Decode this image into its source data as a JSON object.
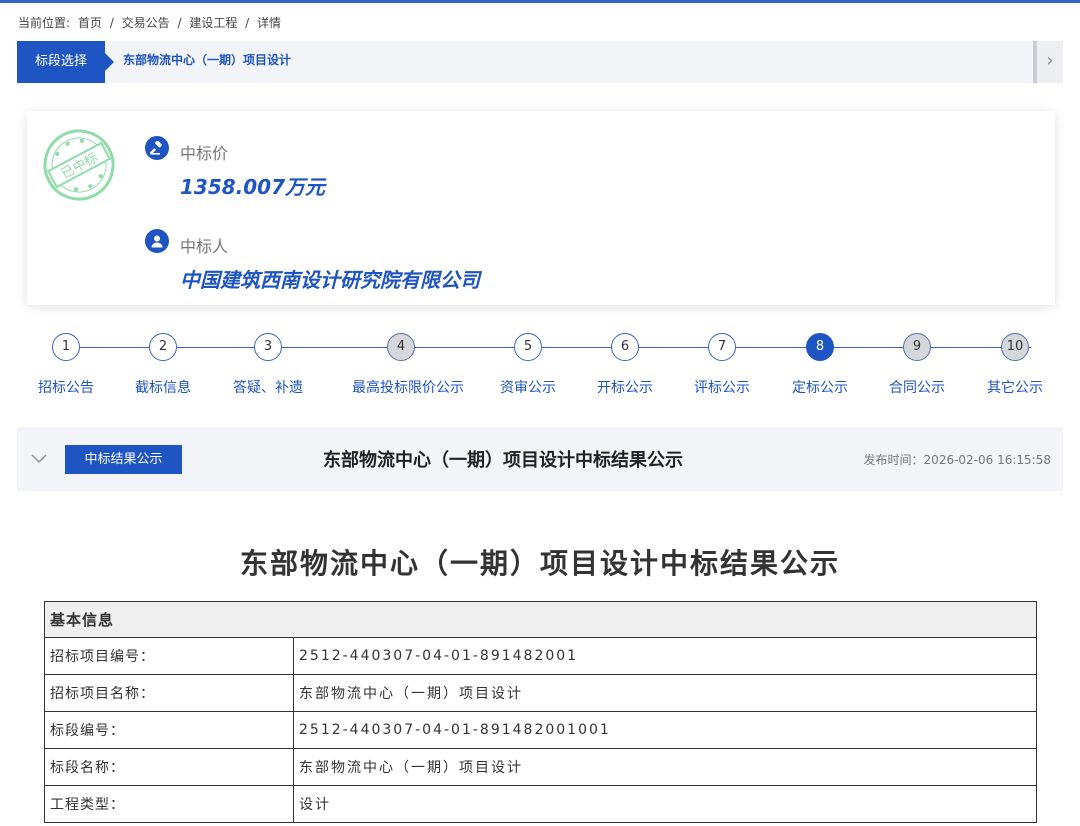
{
  "breadcrumb": {
    "prefix": "当前位置:",
    "items": [
      "首页",
      "/",
      "交易公告",
      "/",
      "建设工程",
      "/",
      "详情"
    ]
  },
  "section_selector": {
    "label": "标段选择",
    "current": "东部物流中心（一期）项目设计"
  },
  "award": {
    "stamp_text": "已中标",
    "price_label": "中标价",
    "price_value": "1358.007万元",
    "winner_label": "中标人",
    "winner_value": "中国建筑西南设计研究院有限公司"
  },
  "steps": [
    {
      "num": "1",
      "label": "招标公告",
      "state": "normal"
    },
    {
      "num": "2",
      "label": "截标信息",
      "state": "normal"
    },
    {
      "num": "3",
      "label": "答疑、补遗",
      "state": "normal"
    },
    {
      "num": "4",
      "label": "最高投标限价公示",
      "state": "grey"
    },
    {
      "num": "5",
      "label": "资审公示",
      "state": "normal"
    },
    {
      "num": "6",
      "label": "开标公示",
      "state": "normal"
    },
    {
      "num": "7",
      "label": "评标公示",
      "state": "normal"
    },
    {
      "num": "8",
      "label": "定标公示",
      "state": "active"
    },
    {
      "num": "9",
      "label": "合同公示",
      "state": "grey"
    },
    {
      "num": "10",
      "label": "其它公示",
      "state": "grey"
    }
  ],
  "result_bar": {
    "tag": "中标结果公示",
    "title": "东部物流中心（一期）项目设计中标结果公示",
    "publish_time": "发布时间：2026-02-06 16:15:58"
  },
  "document": {
    "title": "东部物流中心（一期）项目设计中标结果公示",
    "table_header": "基本信息",
    "rows": [
      {
        "key": "招标项目编号：",
        "value": "2512-440307-04-01-891482001"
      },
      {
        "key": "招标项目名称：",
        "value": "东部物流中心（一期）项目设计"
      },
      {
        "key": "标段编号：",
        "value": "2512-440307-04-01-891482001001"
      },
      {
        "key": "标段名称：",
        "value": "东部物流中心（一期）项目设计"
      },
      {
        "key": "工程类型：",
        "value": "设计"
      }
    ]
  },
  "colors": {
    "accent": "#1e55c2",
    "stamp": "#7fd39a"
  }
}
